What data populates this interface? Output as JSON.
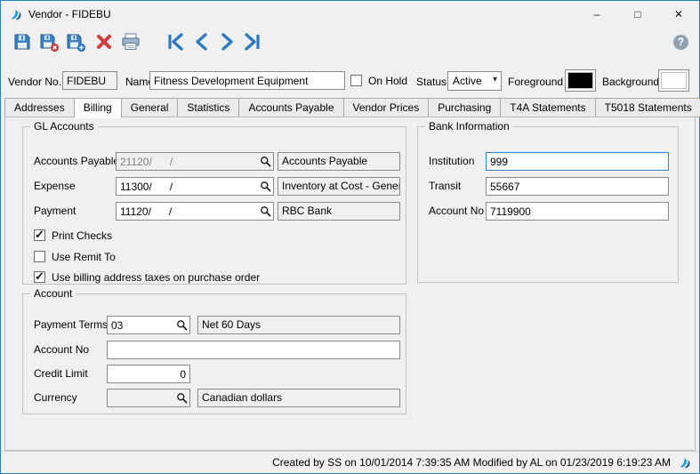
{
  "window": {
    "title": "Vendor - FIDEBU"
  },
  "icons": {
    "minimize": "–",
    "maximize": "□",
    "close": "✕",
    "help": "?",
    "dropdown_arrow": "▾"
  },
  "header": {
    "vendor_no": {
      "label": "Vendor No.",
      "value": "FIDEBU"
    },
    "name": {
      "label": "Name",
      "value": "Fitness Development Equipment"
    },
    "on_hold": {
      "label": "On Hold",
      "checked": false
    },
    "status": {
      "label": "Status",
      "value": "Active"
    },
    "foreground": {
      "label": "Foreground",
      "color": "#000000"
    },
    "background": {
      "label": "Background",
      "color": "#ffffff"
    }
  },
  "tabs": [
    {
      "label": "Addresses",
      "active": false
    },
    {
      "label": "Billing",
      "active": true
    },
    {
      "label": "General",
      "active": false
    },
    {
      "label": "Statistics",
      "active": false
    },
    {
      "label": "Accounts Payable",
      "active": false
    },
    {
      "label": "Vendor Prices",
      "active": false
    },
    {
      "label": "Purchasing",
      "active": false
    },
    {
      "label": "T4A Statements",
      "active": false
    },
    {
      "label": "T5018 Statements",
      "active": false
    }
  ],
  "gl_accounts": {
    "title": "GL Accounts",
    "rows": [
      {
        "label": "Accounts Payable",
        "value": "21120/      /",
        "desc": "Accounts Payable",
        "disabled": true
      },
      {
        "label": "Expense",
        "value": "11300/      /",
        "desc": "Inventory at Cost - Genera",
        "disabled": false
      },
      {
        "label": "Payment",
        "value": "11120/      /",
        "desc": "RBC Bank",
        "disabled": false
      }
    ],
    "checkboxes": [
      {
        "label": "Print Checks",
        "checked": true
      },
      {
        "label": "Use Remit To",
        "checked": false
      },
      {
        "label": "Use billing address taxes on purchase order",
        "checked": true
      }
    ]
  },
  "bank": {
    "title": "Bank Information",
    "fields": [
      {
        "label": "Institution",
        "value": "999",
        "focused": true
      },
      {
        "label": "Transit",
        "value": "55667",
        "focused": false
      },
      {
        "label": "Account No",
        "value": "7119900",
        "focused": false
      }
    ]
  },
  "account": {
    "title": "Account",
    "payment_terms": {
      "label": "Payment Terms",
      "value": "03",
      "desc": "Net 60 Days",
      "disabled": false
    },
    "account_no": {
      "label": "Account No",
      "value": ""
    },
    "credit_limit": {
      "label": "Credit Limit",
      "value": "0"
    },
    "currency": {
      "label": "Currency",
      "value": "",
      "desc": "Canadian dollars",
      "disabled": true
    }
  },
  "statusbar": {
    "text": "Created by SS on 10/01/2014 7:39:35 AM  Modified by AL on 01/23/2019 6:19:23 AM"
  }
}
